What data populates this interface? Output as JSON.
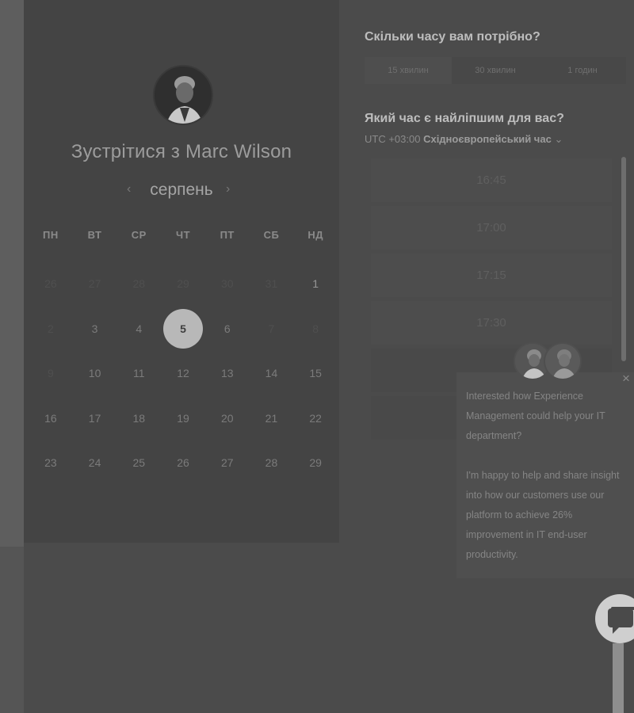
{
  "host": {
    "title": "Зустрітися з Marc Wilson"
  },
  "calendar": {
    "month": "серпень",
    "prev_icon": "chevron-left-icon",
    "next_icon": "chevron-right-icon",
    "weekdays": [
      "ПН",
      "ВТ",
      "СР",
      "ЧТ",
      "ПТ",
      "СБ",
      "НД"
    ],
    "weeks": [
      [
        "26",
        "27",
        "28",
        "29",
        "30",
        "31",
        "1"
      ],
      [
        "2",
        "3",
        "4",
        "5",
        "6",
        "7",
        "8"
      ],
      [
        "9",
        "10",
        "11",
        "12",
        "13",
        "14",
        "15"
      ],
      [
        "16",
        "17",
        "18",
        "19",
        "20",
        "21",
        "22"
      ],
      [
        "23",
        "24",
        "25",
        "26",
        "27",
        "28",
        "29"
      ]
    ],
    "selected_day": "5"
  },
  "duration": {
    "question": "Скільки часу вам потрібно?",
    "options": [
      "15 хвилин",
      "30 хвилин",
      "1 годин"
    ]
  },
  "time": {
    "question": "Який час є найліпшим для вас?",
    "tz_offset": "UTC +03:00",
    "tz_name": "Східноєвропейський час",
    "tz_caret": "⌄",
    "slots": [
      "16:45",
      "17:00",
      "17:15",
      "17:30"
    ]
  },
  "popup": {
    "close": "×",
    "p1": "Interested how Experience Management could help your IT department?",
    "p2": "I'm happy to help and share insight into how our customers use our platform to achieve 26% improvement in IT end-user productivity."
  },
  "colors": {
    "overlay": "#4b4b4b",
    "selected_day_bg": "#b8b8b8"
  }
}
